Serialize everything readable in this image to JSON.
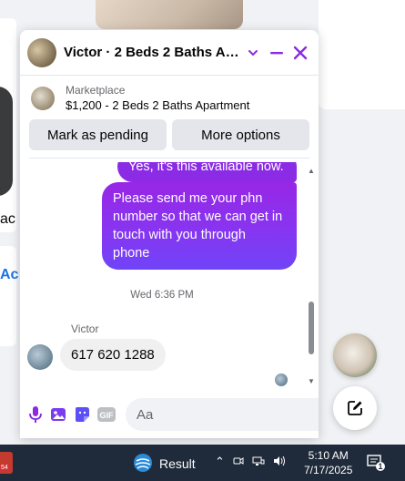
{
  "background": {
    "left_fragment": "ac",
    "left_fragment_link": "Ac"
  },
  "chat": {
    "title": "Victor · 2 Beds 2 Baths Ap...",
    "marketplace": {
      "label": "Marketplace",
      "listing": "$1,200 - 2 Beds 2 Baths Apartment",
      "mark_pending": "Mark as pending",
      "more_options": "More options"
    },
    "messages": {
      "out_1": "Yes, it's this available now.",
      "out_2": "Please send me your phn number so that we can get in touch with you through phone",
      "timestamp": "Wed 6:36 PM",
      "sender": "Victor",
      "in_1": "617 620 1288"
    },
    "composer": {
      "placeholder": "Aa"
    }
  },
  "taskbar": {
    "weather": "Result",
    "badge": "54",
    "time": "5:10 AM",
    "date": "7/17/2025",
    "notification_count": "1"
  },
  "colors": {
    "accent": "#8a2be2",
    "messenger_blue": "#0a7cff",
    "taskbar": "#1f2a3a"
  }
}
